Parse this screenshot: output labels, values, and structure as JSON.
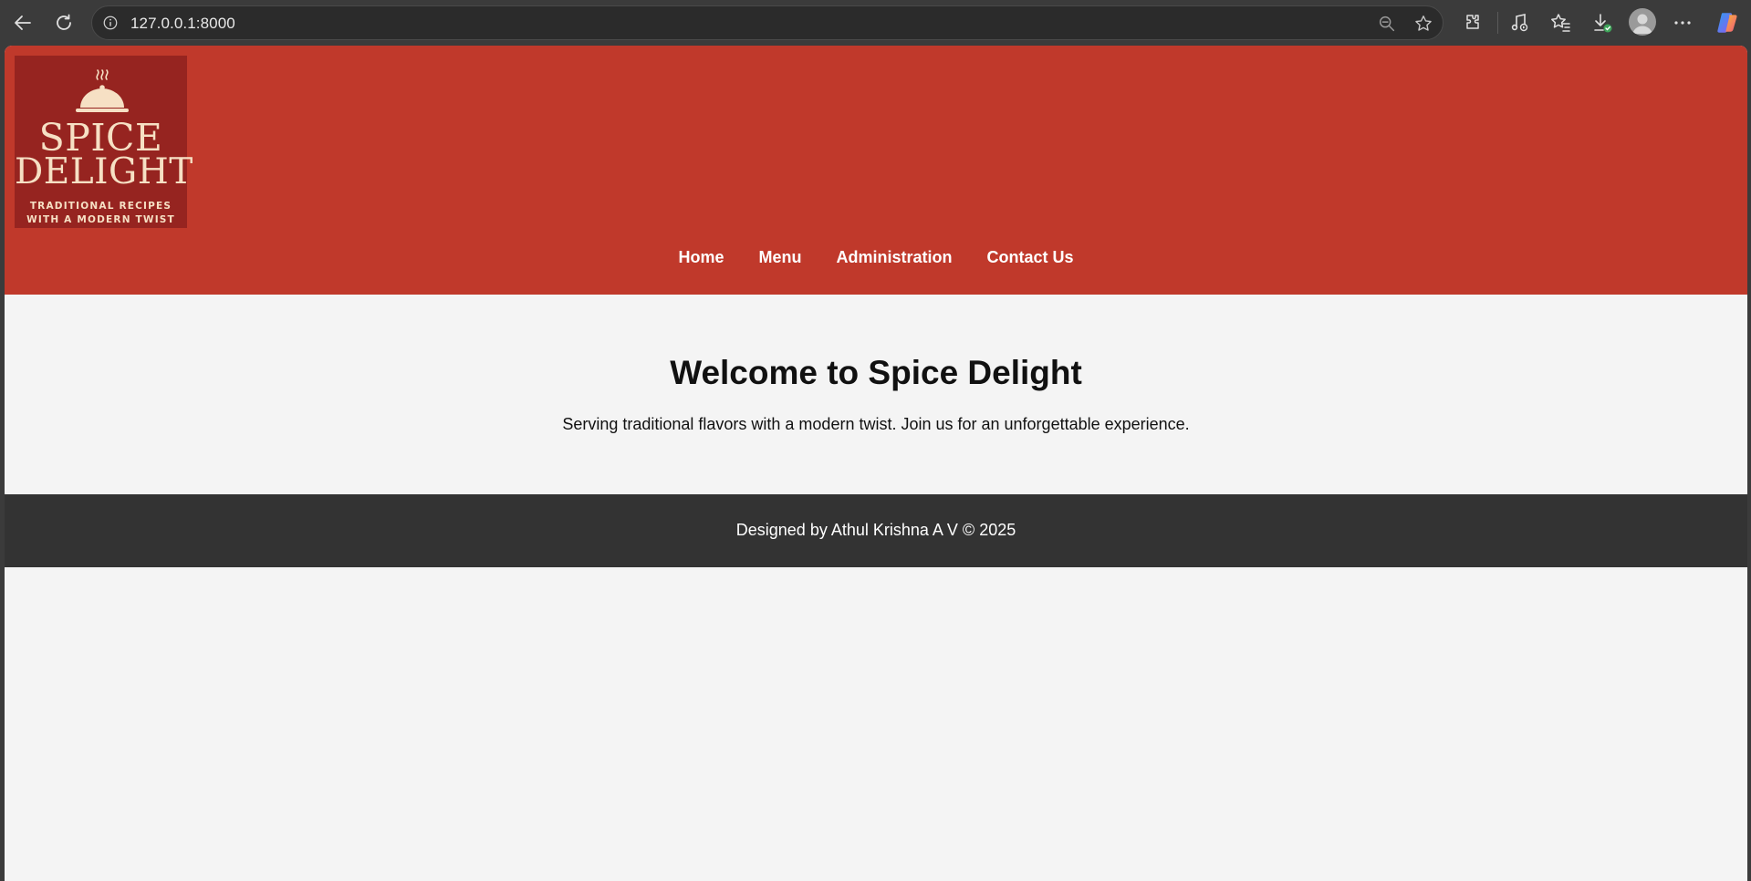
{
  "browser": {
    "url": "127.0.0.1:8000",
    "icons": [
      "back-icon",
      "refresh-icon",
      "site-info-icon",
      "zoom-out-icon",
      "favorite-star-icon",
      "extensions-icon",
      "media-control-icon",
      "favorites-icon",
      "downloads-icon",
      "profile-icon",
      "more-icon",
      "copilot-icon"
    ]
  },
  "site": {
    "logo": {
      "line1": "SPICE",
      "line2": "DELIGHT",
      "tagline1": "TRADITIONAL RECIPES",
      "tagline2": "WITH A MODERN TWIST"
    },
    "nav": [
      {
        "label": "Home"
      },
      {
        "label": "Menu"
      },
      {
        "label": "Administration"
      },
      {
        "label": "Contact Us"
      }
    ],
    "hero": {
      "title": "Welcome to Spice Delight",
      "subtitle": "Serving traditional flavors with a modern twist. Join us for an unforgettable experience."
    },
    "footer": {
      "text": "Designed by Athul Krishna A V © 2025"
    }
  },
  "colors": {
    "header": "#c0392b",
    "logo_bg": "#962420",
    "logo_text": "#f6e0c4",
    "page_bg": "#f4f4f4",
    "footer_bg": "#333333"
  }
}
